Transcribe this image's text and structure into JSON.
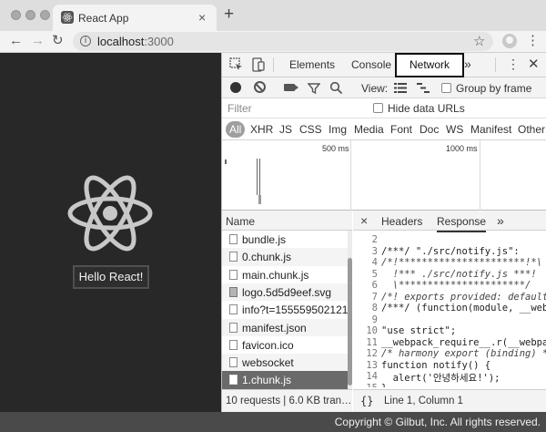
{
  "browser": {
    "tab_title": "React App",
    "tab_close": "×",
    "new_tab": "+",
    "nav": {
      "back": "←",
      "forward": "→",
      "reload": "↻"
    },
    "url_host": "localhost",
    "url_port": ":3000",
    "info_icon": "i",
    "bookmark_star": "☆",
    "menu": "⋮"
  },
  "page": {
    "button_label": "Hello React!",
    "logo_color": "#c8c8c8",
    "background": "#282828"
  },
  "devtools": {
    "tabs": [
      "Elements",
      "Console",
      "Network"
    ],
    "active_tab": "Network",
    "more": "»",
    "menu": "⋮",
    "close": "✕",
    "toolbar": {
      "view_label": "View:",
      "group_by_frame": "Group by frame"
    },
    "filter": {
      "placeholder": "Filter",
      "hide_data_urls": "Hide data URLs"
    },
    "type_filters": [
      "All",
      "XHR",
      "JS",
      "CSS",
      "Img",
      "Media",
      "Font",
      "Doc",
      "WS",
      "Manifest",
      "Other"
    ],
    "timeline": {
      "label_500": "500 ms",
      "label_1000": "1000 ms"
    },
    "requests": {
      "header": "Name",
      "items": [
        {
          "name": "bundle.js",
          "icon": "file-icon"
        },
        {
          "name": "0.chunk.js",
          "icon": "file-icon"
        },
        {
          "name": "main.chunk.js",
          "icon": "file-icon"
        },
        {
          "name": "logo.5d5d9eef.svg",
          "icon": "image-icon"
        },
        {
          "name": "info?t=1555595021217",
          "icon": "file-icon"
        },
        {
          "name": "manifest.json",
          "icon": "file-icon"
        },
        {
          "name": "favicon.ico",
          "icon": "file-icon"
        },
        {
          "name": "websocket",
          "icon": "file-icon"
        },
        {
          "name": "1.chunk.js",
          "icon": "file-icon"
        }
      ],
      "selected": "1.chunk.js",
      "status": "10 requests | 6.0 KB tran…"
    },
    "response": {
      "close": "×",
      "tabs": [
        "Headers",
        "Response"
      ],
      "active_tab": "Response",
      "more": "»",
      "lines": [
        {
          "n": "2",
          "text": ""
        },
        {
          "n": "3",
          "text": "/***/ \"./src/notify.js\":"
        },
        {
          "n": "4",
          "text": "/*!**********************!*\\"
        },
        {
          "n": "5",
          "text": "  !*** ./src/notify.js ***!"
        },
        {
          "n": "6",
          "text": "  \\**********************/"
        },
        {
          "n": "7",
          "text": "/*! exports provided: default"
        },
        {
          "n": "8",
          "text": "/***/ (function(module, __web"
        },
        {
          "n": "9",
          "text": ""
        },
        {
          "n": "10",
          "text": "\"use strict\";"
        },
        {
          "n": "11",
          "text": "__webpack_require__.r(__webpa"
        },
        {
          "n": "12",
          "text": "/* harmony export (binding) *"
        },
        {
          "n": "13",
          "text": "function notify() {"
        },
        {
          "n": "14",
          "text": "  alert('안녕하세요!');"
        },
        {
          "n": "15",
          "text": "}"
        }
      ],
      "status_braces": "{}",
      "cursor": "Line 1, Column 1"
    }
  },
  "copyright": "Copyright © Gilbut, Inc. All rights reserved."
}
